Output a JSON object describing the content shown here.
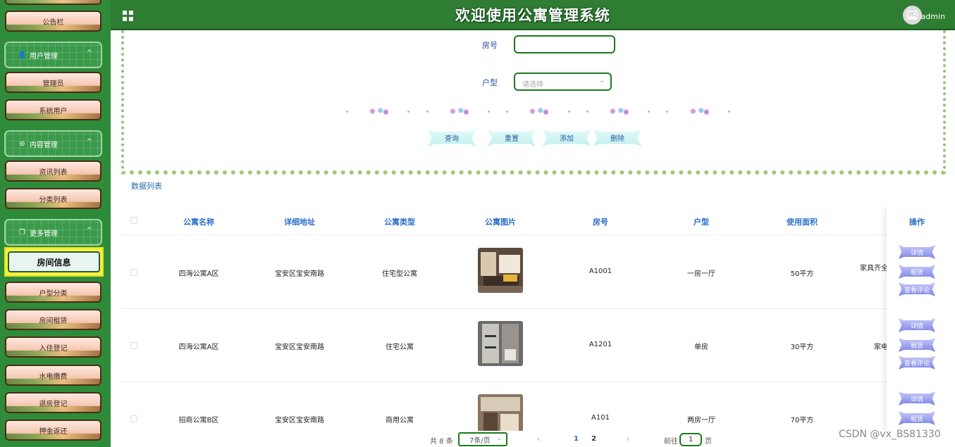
{
  "header": {
    "title": "欢迎使用公寓管理系统",
    "user": "admin"
  },
  "sidebar": {
    "items": [
      {
        "label": "公告栏",
        "type": "item"
      },
      {
        "label": "用户管理",
        "type": "group"
      },
      {
        "label": "管理员",
        "type": "item"
      },
      {
        "label": "系统用户",
        "type": "item"
      },
      {
        "label": "内容管理",
        "type": "group"
      },
      {
        "label": "资讯列表",
        "type": "item"
      },
      {
        "label": "分类列表",
        "type": "item"
      },
      {
        "label": "更多管理",
        "type": "group"
      },
      {
        "label": "房间信息",
        "type": "active"
      },
      {
        "label": "户型分类",
        "type": "item"
      },
      {
        "label": "房间租赁",
        "type": "item"
      },
      {
        "label": "入住登记",
        "type": "item"
      },
      {
        "label": "水电缴费",
        "type": "item"
      },
      {
        "label": "退房登记",
        "type": "item"
      },
      {
        "label": "押金返还",
        "type": "item"
      }
    ]
  },
  "search": {
    "room_label": "房号",
    "room_value": "",
    "type_label": "户型",
    "type_placeholder": "请选择",
    "buttons": {
      "query": "查询",
      "reset": "重置",
      "add": "添加",
      "delete": "删除"
    }
  },
  "list_title": "数据列表",
  "table": {
    "columns": [
      "公寓名称",
      "详细地址",
      "公寓类型",
      "公寓图片",
      "房号",
      "户型",
      "使用面积",
      "操作"
    ],
    "rows": [
      {
        "name": "四海公寓A区",
        "address": "宝安区宝安南路",
        "type": "住宅型公寓",
        "room": "A1001",
        "layout": "一房一厅",
        "area": "50平方",
        "extra": "家具齐全"
      },
      {
        "name": "四海公寓A区",
        "address": "宝安区宝安南路",
        "type": "住宅公寓",
        "room": "A1201",
        "layout": "单房",
        "area": "30平方",
        "extra": "家电"
      },
      {
        "name": "招商公寓B区",
        "address": "宝安区宝安南路",
        "type": "商用公寓",
        "room": "A101",
        "layout": "两房一厅",
        "area": "70平方",
        "extra": ""
      }
    ],
    "actions": {
      "detail": "详情",
      "rent": "租赁",
      "comments": "查看评论"
    }
  },
  "pagination": {
    "total": "共 8 条",
    "page_size": "7条/页",
    "pages": [
      "1",
      "2"
    ],
    "current": "1",
    "goto_label": "前往",
    "goto_value": "1",
    "page_suffix": "页"
  },
  "watermark": "CSDN @vx_BS81330",
  "colors": {
    "header": "#2e7d32",
    "sidebar": "#2e8b3a",
    "accent_link": "#2a6fc9",
    "active_item": "#f6f042"
  }
}
